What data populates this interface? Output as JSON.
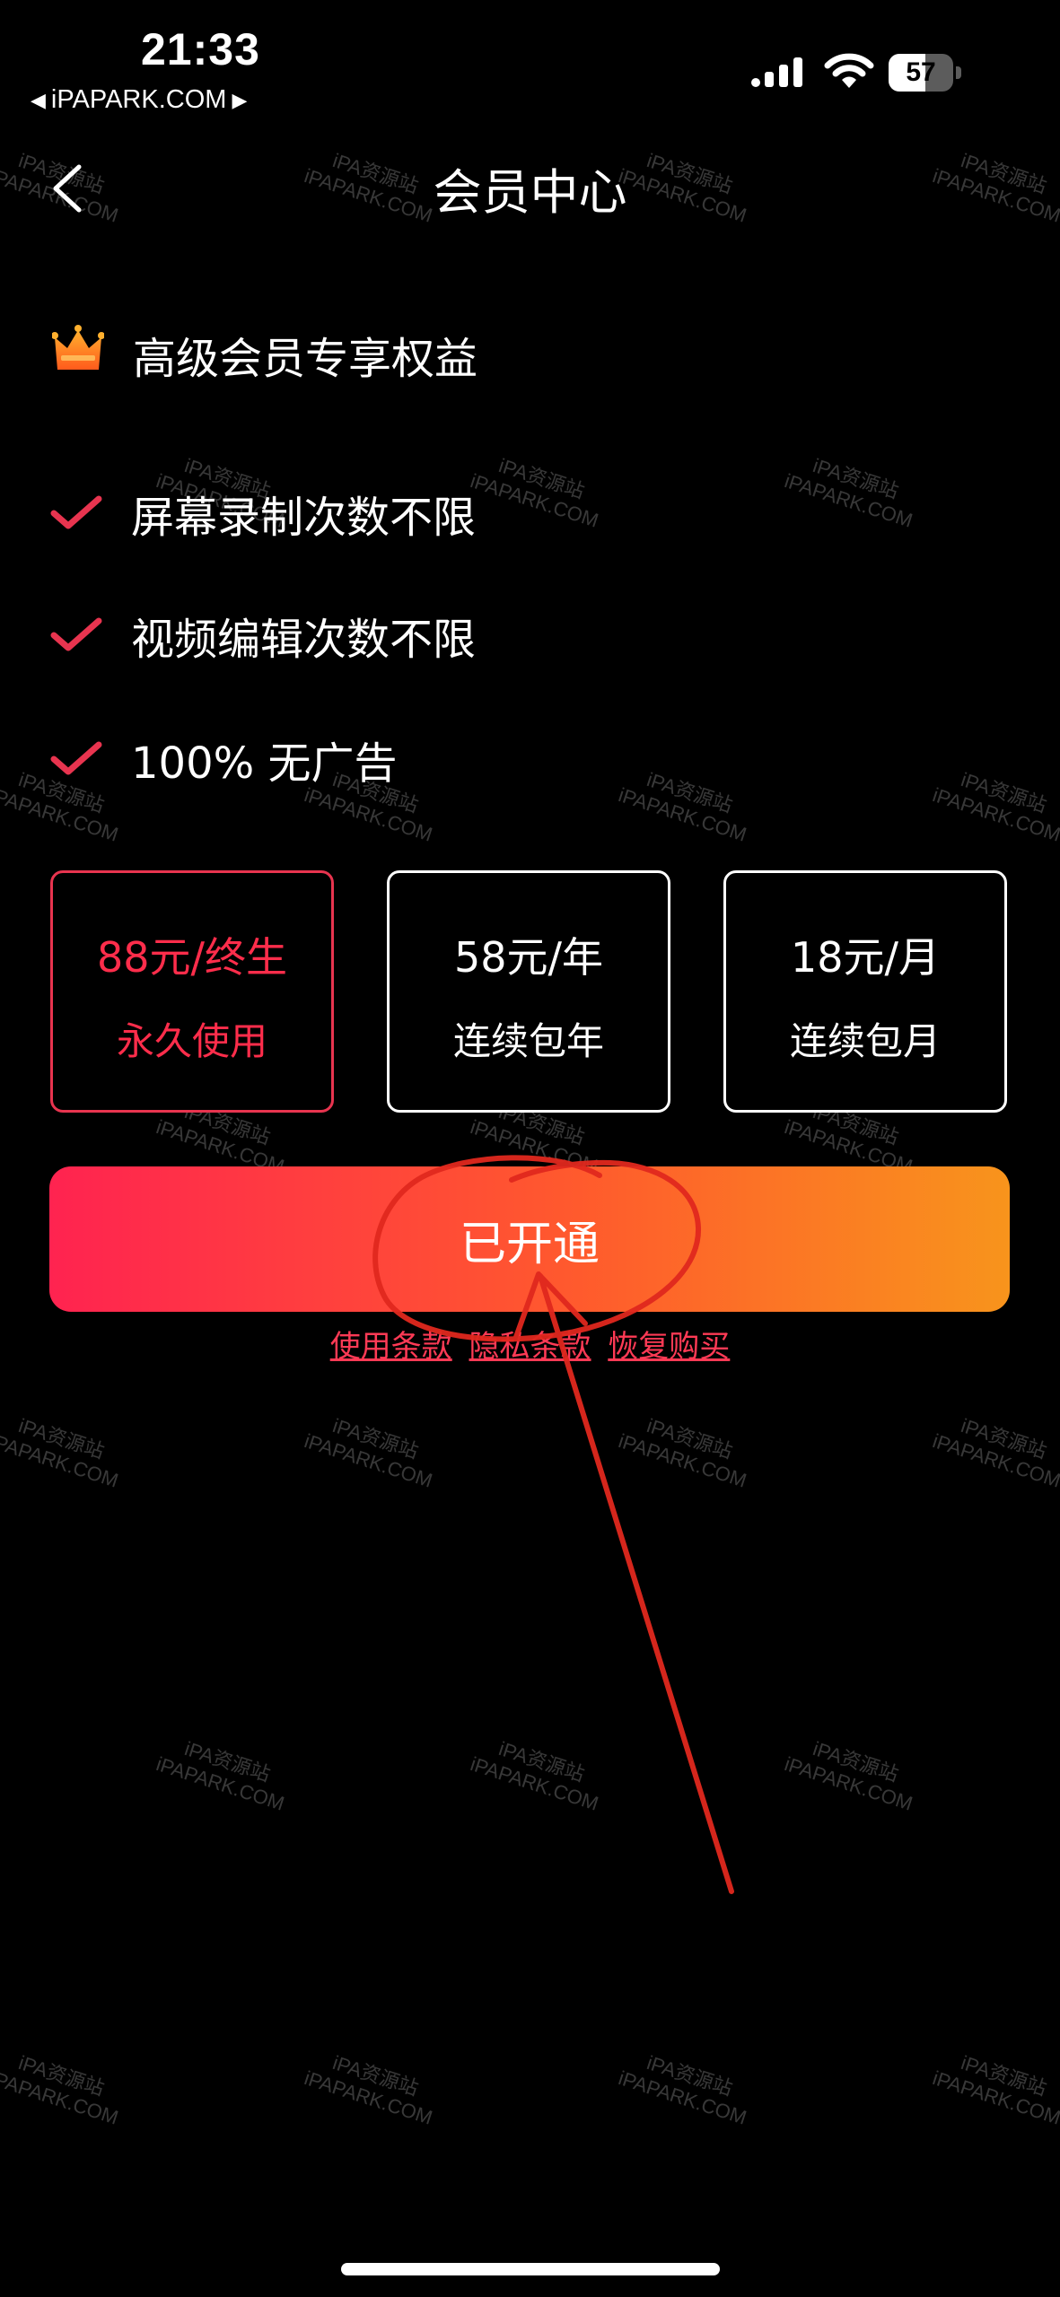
{
  "status_bar": {
    "time": "21:33",
    "back_app": "iPAPARK.COM",
    "battery_level": "57",
    "battery_percent": 57
  },
  "nav": {
    "title": "会员中心"
  },
  "vip": {
    "title": "高级会员专享权益"
  },
  "benefits": [
    {
      "label": "屏幕录制次数不限"
    },
    {
      "label": "视频编辑次数不限"
    },
    {
      "label": "100% 无广告"
    }
  ],
  "plans": [
    {
      "price": "88元/终生",
      "desc": "永久使用",
      "selected": true
    },
    {
      "price": "58元/年",
      "desc": "连续包年",
      "selected": false
    },
    {
      "price": "18元/月",
      "desc": "连续包月",
      "selected": false
    }
  ],
  "cta": {
    "label": "已开通"
  },
  "links": {
    "terms": "使用条款",
    "privacy": "隐私条款",
    "restore": "恢复购买"
  },
  "watermark": {
    "line1": "iPA资源站",
    "line2": "iPAPARK.COM"
  },
  "colors": {
    "accent": "#ff2d4b",
    "gradient_start": "#ff2350",
    "gradient_end": "#f8941c",
    "annotation": "#e0281e"
  }
}
